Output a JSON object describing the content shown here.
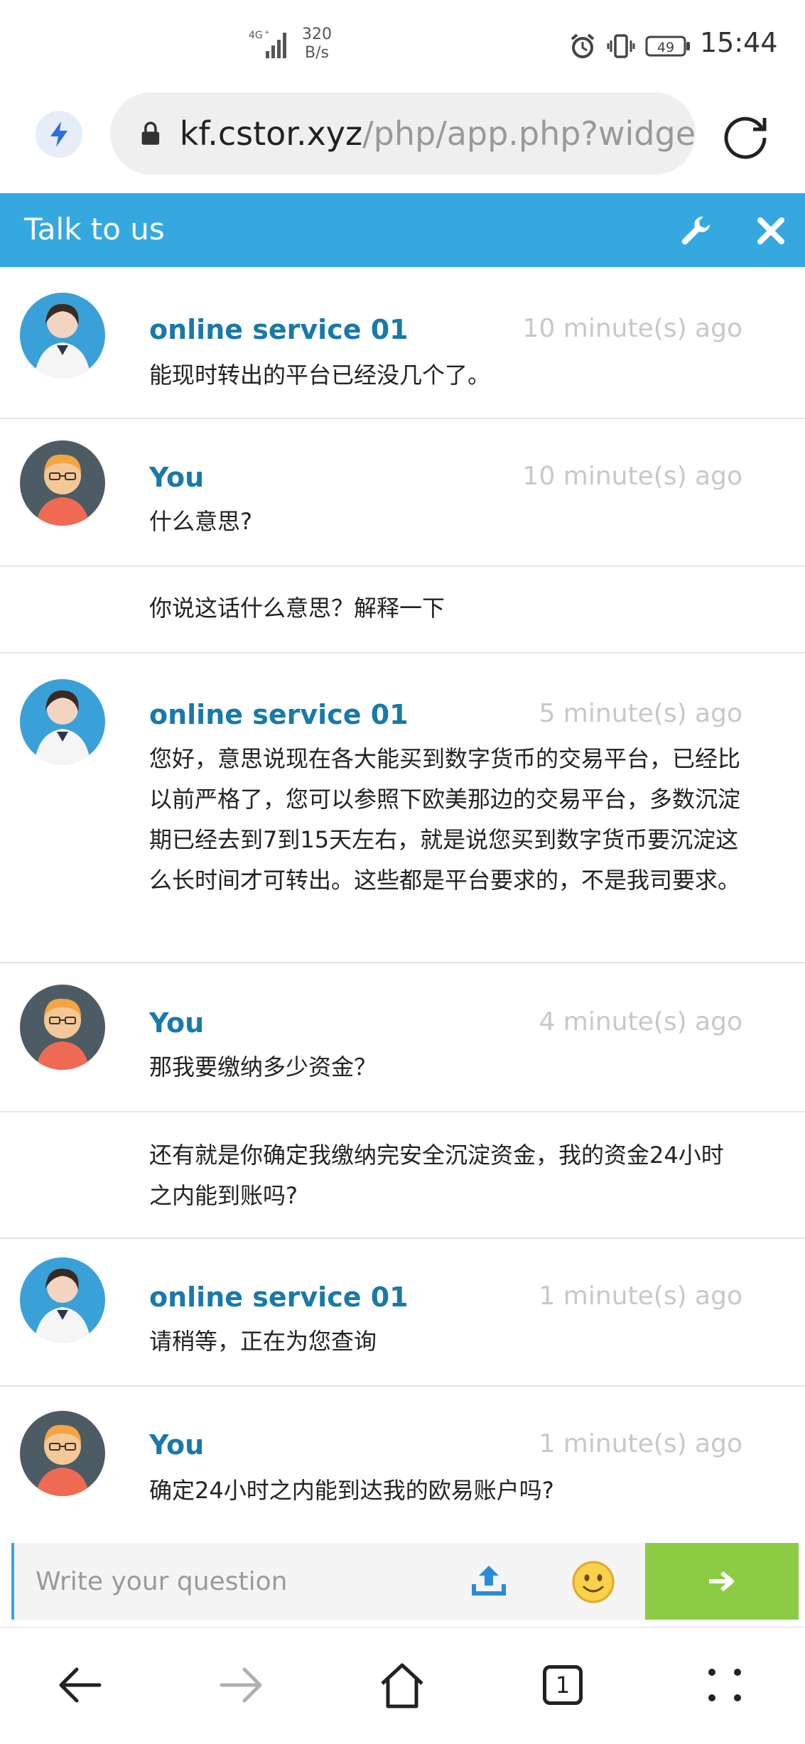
{
  "status_bar": {
    "network": "4G",
    "speed_value": "320",
    "speed_unit": "B/s",
    "battery": "49",
    "clock": "15:44"
  },
  "browser": {
    "url_host": "kf.cstor.xyz",
    "url_path": "/php/app.php?widge"
  },
  "chat": {
    "title": "Talk to us",
    "messages": [
      {
        "sender": "online service 01",
        "time": "10 minute(s) ago",
        "text": "能现时转出的平台已经没几个了。"
      },
      {
        "sender": "You",
        "time": "10 minute(s) ago",
        "text": "什么意思?"
      },
      {
        "text": "你说这话什么意思？解释一下"
      },
      {
        "sender": "online service 01",
        "time": "5 minute(s) ago",
        "text": "您好，意思说现在各大能买到数字货币的交易平台，已经比以前严格了，您可以参照下欧美那边的交易平台，多数沉淀期已经去到7到15天左右，就是说您买到数字货币要沉淀这么长时间才可转出。这些都是平台要求的，不是我司要求。"
      },
      {
        "sender": "You",
        "time": "4 minute(s) ago",
        "text": "那我要缴纳多少资金？"
      },
      {
        "text": "还有就是你确定我缴纳完安全沉淀资金，我的资金24小时之内能到账吗?"
      },
      {
        "sender": "online service 01",
        "time": "1 minute(s) ago",
        "text": "请稍等，正在为您查询"
      },
      {
        "sender": "You",
        "time": "1 minute(s) ago",
        "text": "确定24小时之内能到达我的欧易账户吗?"
      }
    ]
  },
  "input": {
    "placeholder": "Write your question"
  },
  "bottom_nav": {
    "tab_count": "1"
  }
}
